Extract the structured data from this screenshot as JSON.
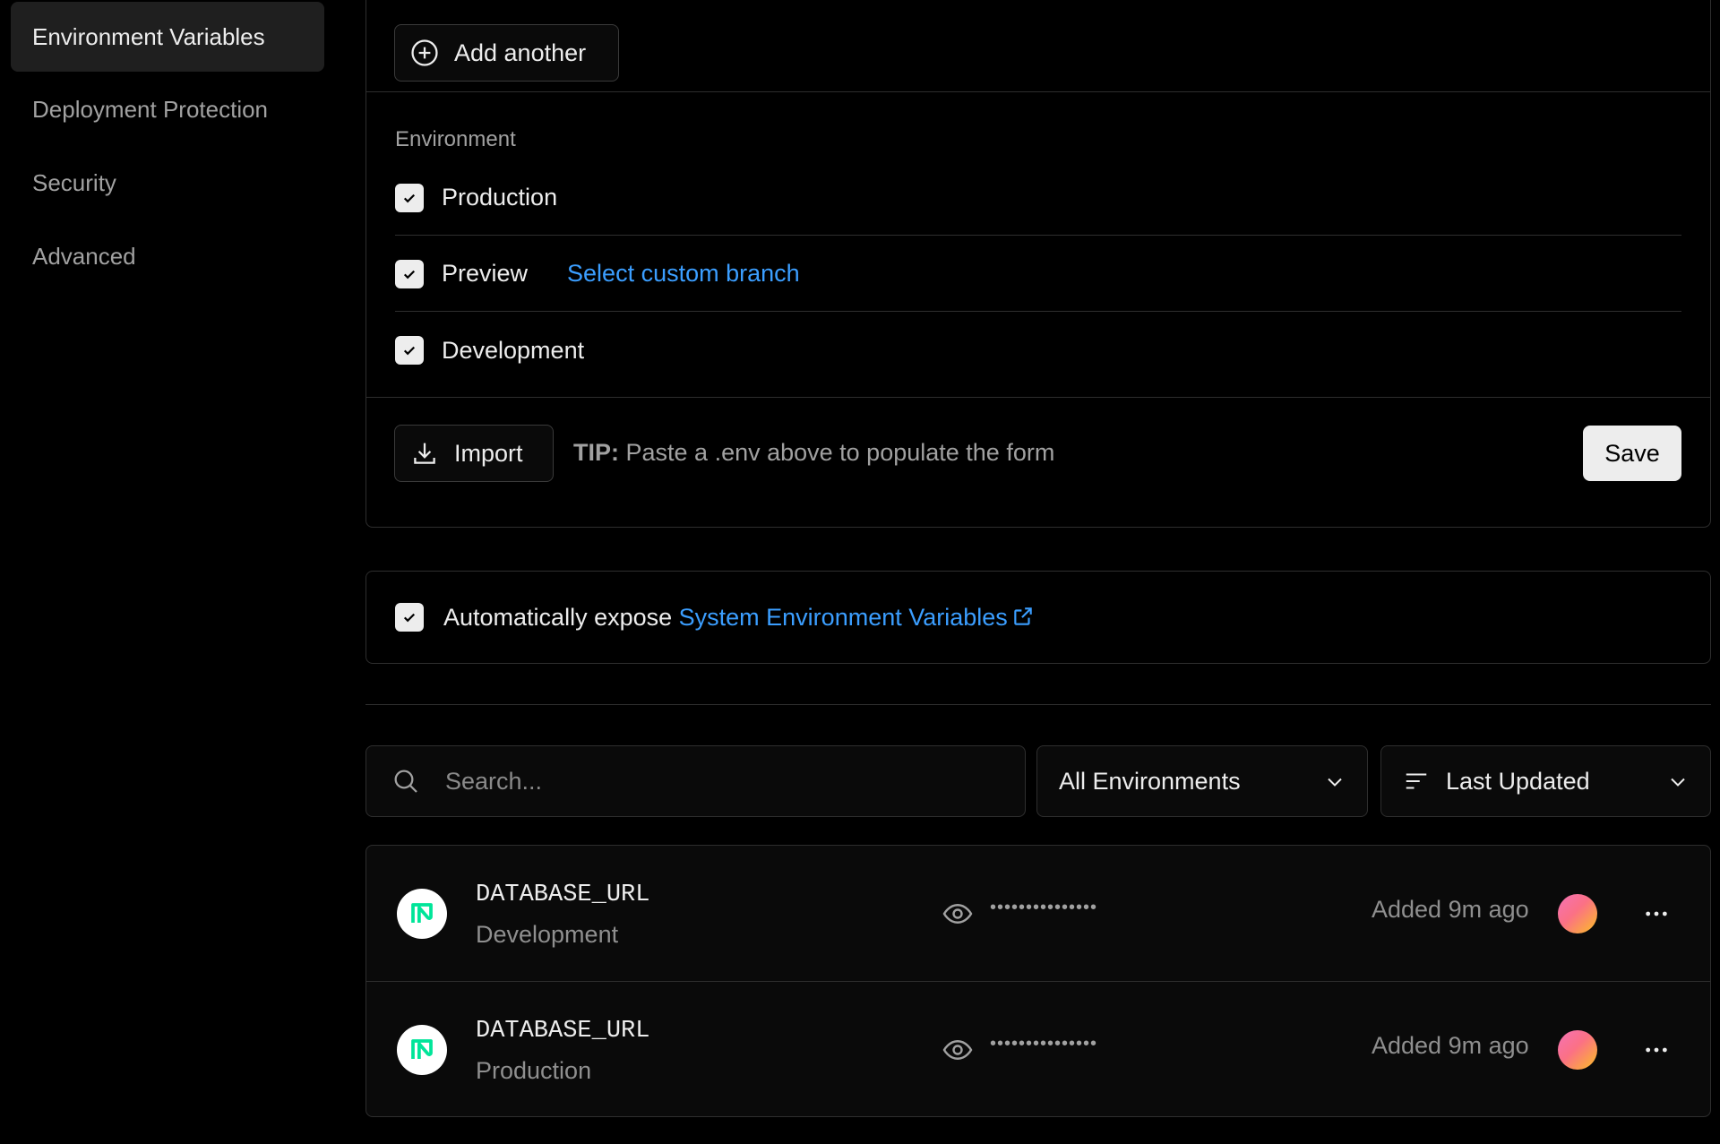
{
  "sidebar": {
    "items": [
      {
        "label": "Environment Variables",
        "active": true
      },
      {
        "label": "Deployment Protection",
        "active": false
      },
      {
        "label": "Security",
        "active": false
      },
      {
        "label": "Advanced",
        "active": false
      }
    ]
  },
  "form": {
    "add_another_label": "Add another",
    "environment_label": "Environment",
    "environments": [
      {
        "label": "Production",
        "checked": true
      },
      {
        "label": "Preview",
        "checked": true,
        "link": "Select custom branch"
      },
      {
        "label": "Development",
        "checked": true
      }
    ],
    "import_label": "Import",
    "tip_prefix": "TIP:",
    "tip_text": " Paste a .env above to populate the form",
    "save_label": "Save"
  },
  "expose": {
    "checked": true,
    "text": "Automatically expose ",
    "link": "System Environment Variables"
  },
  "filters": {
    "search_placeholder": "Search...",
    "environment_filter": "All Environments",
    "sort": "Last Updated"
  },
  "variables": [
    {
      "name": "DATABASE_URL",
      "environment": "Development",
      "masked": "•••••••••••••••",
      "added": "Added 9m ago"
    },
    {
      "name": "DATABASE_URL",
      "environment": "Production",
      "masked": "•••••••••••••••",
      "added": "Added 9m ago"
    }
  ],
  "colors": {
    "background": "#000000",
    "link": "#3b9eff",
    "neon_green": "#00e599"
  }
}
